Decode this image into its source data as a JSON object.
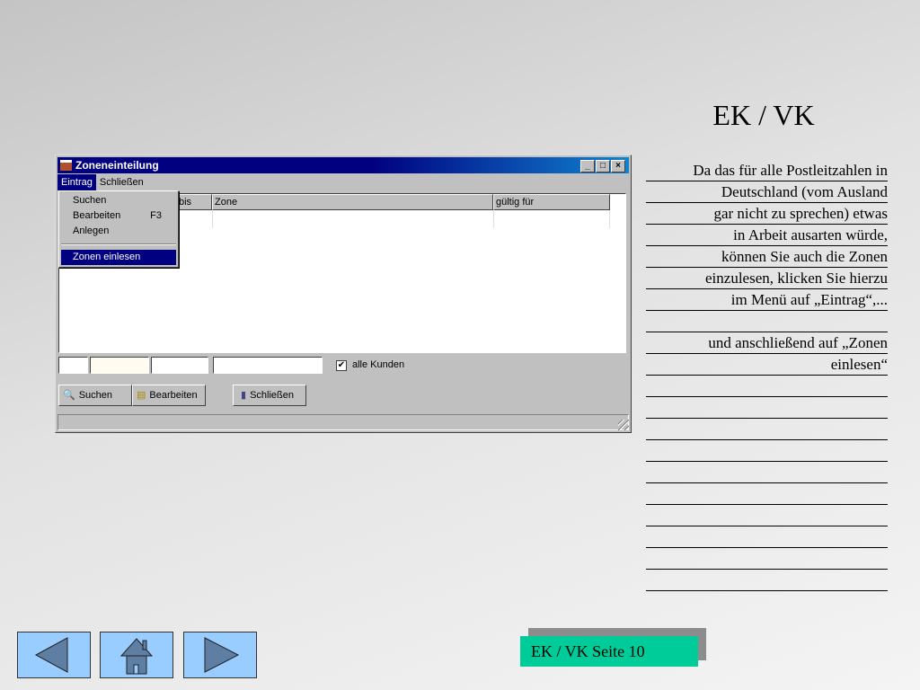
{
  "slide": {
    "title": "EK / VK",
    "page_label": "EK / VK Seite 10"
  },
  "window": {
    "title": "Zoneneinteilung",
    "menu": [
      "Eintrag",
      "Schließen"
    ],
    "dropdown": {
      "items": [
        "Suchen",
        "Bearbeiten",
        "Anlegen",
        "Zonen einlesen"
      ],
      "shortcut_bearbeiten": "F3"
    },
    "columns": [
      "bis",
      "Zone",
      "gültig für"
    ],
    "checkbox_label": "alle Kunden",
    "checkbox_checked": true,
    "buttons": [
      "Suchen",
      "Bearbeiten",
      "Schließen"
    ]
  },
  "text_lines": [
    "Da das für alle Postleitzahlen in",
    "Deutschland (vom Ausland",
    "gar nicht zu sprechen) etwas",
    "in Arbeit ausarten würde,",
    "können Sie auch die Zonen",
    "einzulesen, klicken Sie hierzu",
    "im Menü auf „Eintrag“,...",
    "",
    "und anschließend auf „Zonen",
    "einlesen“",
    "",
    "",
    "",
    "",
    "",
    "",
    "",
    "",
    "",
    ""
  ],
  "nav": [
    "previous",
    "home",
    "next"
  ],
  "colors": {
    "nav": "#99ccff",
    "page_badge": "#00cc99",
    "titlebar": "#000080"
  }
}
